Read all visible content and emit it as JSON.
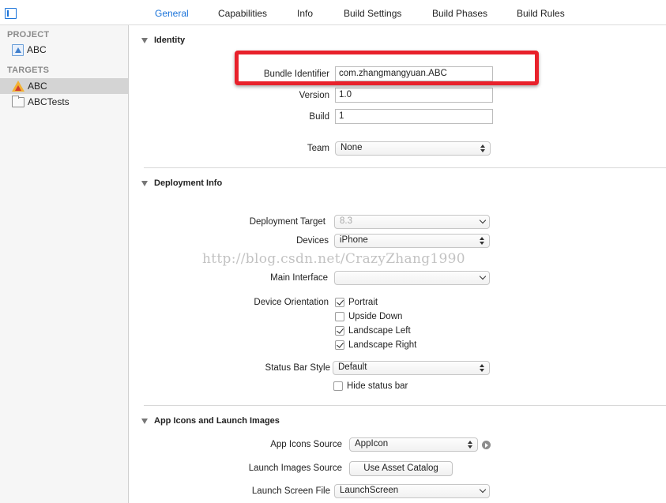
{
  "tabs": [
    {
      "label": "General",
      "active": true
    },
    {
      "label": "Capabilities",
      "active": false
    },
    {
      "label": "Info",
      "active": false
    },
    {
      "label": "Build Settings",
      "active": false
    },
    {
      "label": "Build Phases",
      "active": false
    },
    {
      "label": "Build Rules",
      "active": false
    }
  ],
  "sidebar": {
    "project_heading": "PROJECT",
    "project_item": "ABC",
    "targets_heading": "TARGETS",
    "targets": [
      {
        "label": "ABC",
        "selected": true,
        "icon": "app-target-icon"
      },
      {
        "label": "ABCTests",
        "selected": false,
        "icon": "test-bundle-icon"
      }
    ]
  },
  "identity": {
    "title": "Identity",
    "bundle_identifier_label": "Bundle Identifier",
    "bundle_identifier": "com.zhangmangyuan.ABC",
    "version_label": "Version",
    "version": "1.0",
    "build_label": "Build",
    "build": "1",
    "team_label": "Team",
    "team": "None"
  },
  "deployment": {
    "title": "Deployment Info",
    "target_label": "Deployment Target",
    "target": "8.3",
    "devices_label": "Devices",
    "devices": "iPhone",
    "main_interface_label": "Main Interface",
    "main_interface": "",
    "orientation_label": "Device Orientation",
    "orientations": [
      {
        "label": "Portrait",
        "checked": true
      },
      {
        "label": "Upside Down",
        "checked": false
      },
      {
        "label": "Landscape Left",
        "checked": true
      },
      {
        "label": "Landscape Right",
        "checked": true
      }
    ],
    "status_bar_label": "Status Bar Style",
    "status_bar": "Default",
    "hide_status_bar": {
      "label": "Hide status bar",
      "checked": false
    }
  },
  "icons": {
    "title": "App Icons and Launch Images",
    "app_icons_label": "App Icons Source",
    "app_icons": "AppIcon",
    "launch_images_label": "Launch Images Source",
    "launch_images_button": "Use Asset Catalog",
    "launch_screen_label": "Launch Screen File",
    "launch_screen": "LaunchScreen"
  },
  "watermark": "http://blog.csdn.net/CrazyZhang1990",
  "colors": {
    "accent": "#1a73d9",
    "highlight": "#e8212b"
  }
}
